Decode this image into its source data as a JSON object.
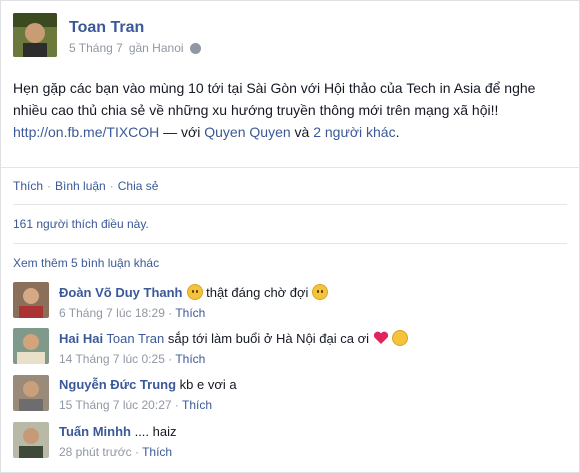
{
  "post": {
    "author": "Toan Tran",
    "date": "5 Tháng 7",
    "location": "gần Hanoi",
    "text_before_link": "Hẹn gặp các bạn vào mùng 10 tới tại Sài Gòn với Hội thảo của Tech in Asia để nghe nhiều cao thủ chia sẻ về những xu hướng truyền thông mới trên mạng xã hội!! ",
    "link": "http://on.fb.me/TIXCOH",
    "with_prefix": " — với ",
    "tagged_user": "Quyen Quyen",
    "and_text": " và ",
    "others": "2 người khác",
    "end": "."
  },
  "actions": {
    "like": "Thích",
    "comment": "Bình luận",
    "share": "Chia sẻ",
    "separator": " · "
  },
  "likes_summary": "161 người thích điều này.",
  "more_comments": "Xem thêm 5 bình luận khác",
  "comments": [
    {
      "name": "Đoàn Võ Duy Thanh",
      "text": " thật đáng chờ đợi ",
      "time": "6 Tháng 7 lúc 18:29",
      "like": "Thích"
    },
    {
      "name": "Hai Hai",
      "mention": "Toan Tran",
      "text": " sắp tới làm buổi ở Hà Nội đại ca ơi ",
      "time": "14 Tháng 7 lúc 0:25",
      "like": "Thích"
    },
    {
      "name": "Nguyễn Đức Trung",
      "text": " kb e vơi a",
      "time": "15 Tháng 7 lúc 20:27",
      "like": "Thích"
    },
    {
      "name": "Tuấn Minhh",
      "text": " .... haiz",
      "time": "28 phút trước",
      "like": "Thích"
    }
  ],
  "colors": {
    "link": "#3b5998",
    "meta": "#9197a3",
    "text": "#141823"
  }
}
